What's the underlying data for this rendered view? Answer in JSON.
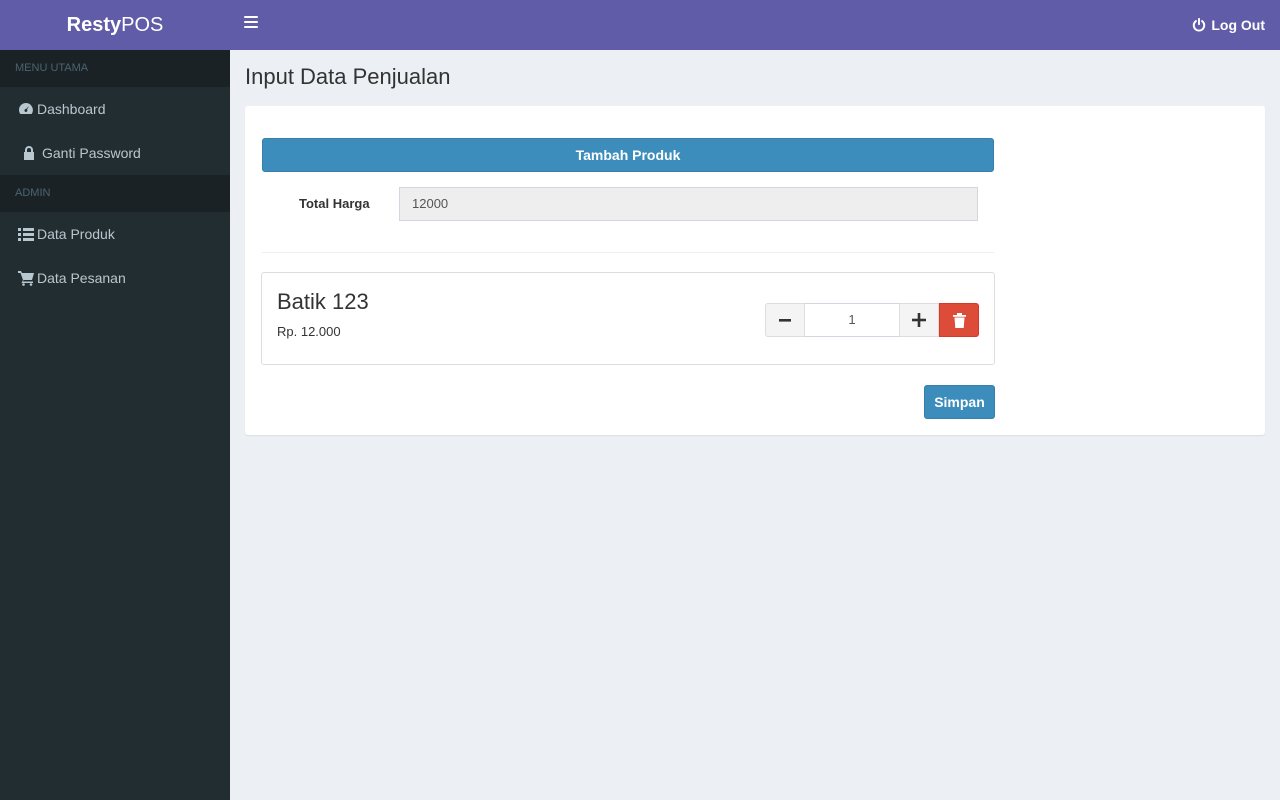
{
  "app": {
    "brand_bold": "Resty",
    "brand_rest": "POS"
  },
  "header": {
    "logout_label": "Log Out"
  },
  "sidebar": {
    "sections": [
      {
        "title": "MENU UTAMA",
        "items": [
          {
            "label": "Dashboard",
            "icon": "dashboard-icon"
          },
          {
            "label": "Ganti Password",
            "icon": "lock-icon"
          }
        ]
      },
      {
        "title": "ADMIN",
        "items": [
          {
            "label": "Data Produk",
            "icon": "list-icon"
          },
          {
            "label": "Data Pesanan",
            "icon": "cart-icon"
          }
        ]
      }
    ]
  },
  "page": {
    "title": "Input Data Penjualan"
  },
  "form": {
    "add_product_label": "Tambah Produk",
    "total_label": "Total Harga",
    "total_value": "12000",
    "save_label": "Simpan"
  },
  "items": [
    {
      "name": "Batik 123",
      "price": "Rp. 12.000",
      "qty": "1"
    }
  ],
  "colors": {
    "header": "#605ca8",
    "sidebar": "#222d32",
    "primary": "#3c8dbc",
    "danger": "#dd4b39"
  }
}
